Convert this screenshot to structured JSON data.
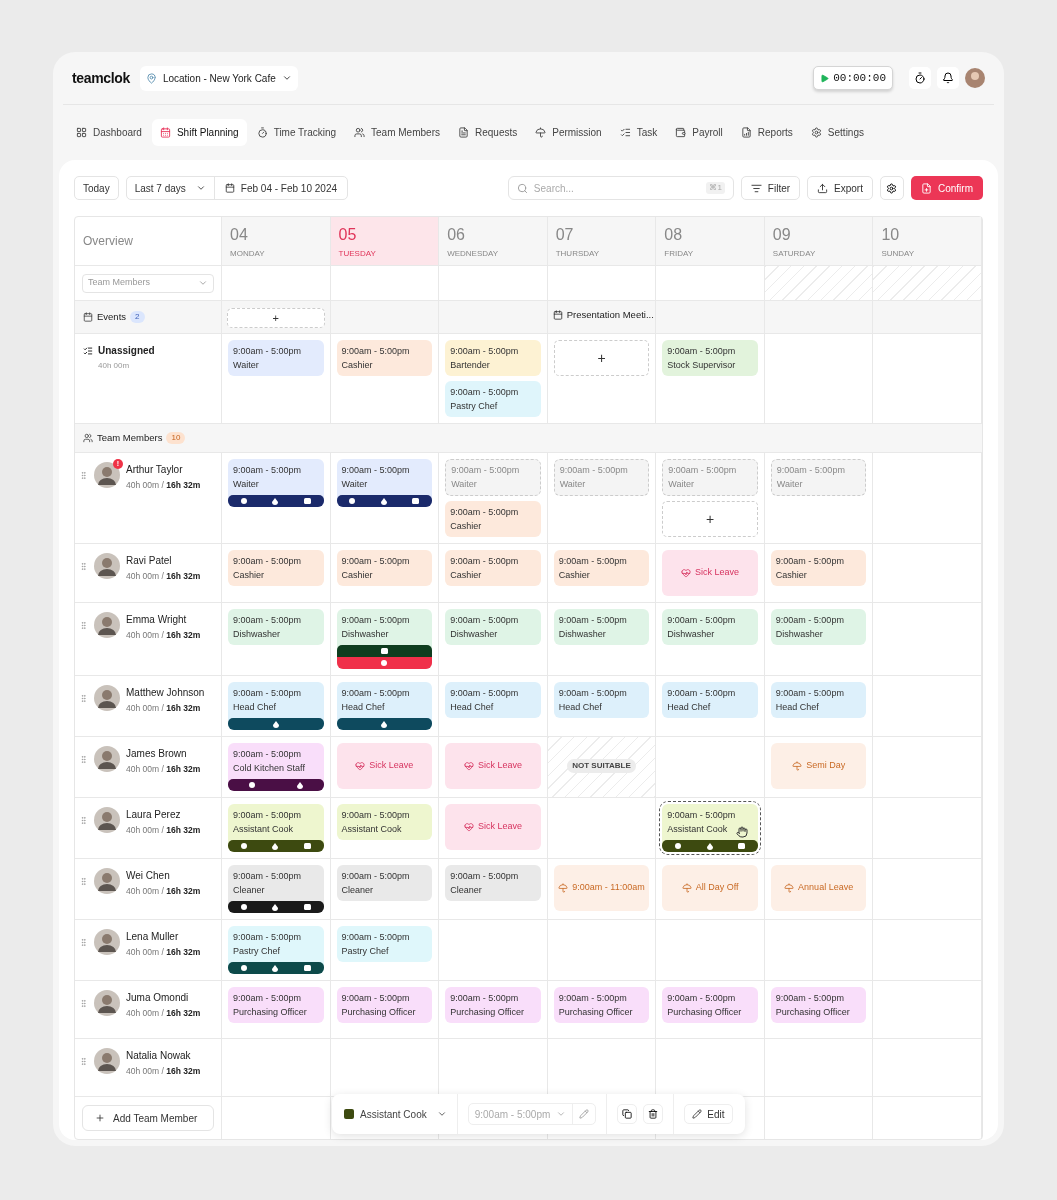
{
  "brand": "teamclok",
  "location": "Location - New York Cafe",
  "timer": "00:00:00",
  "nav": [
    {
      "label": "Dashboard",
      "selected": false
    },
    {
      "label": "Shift Planning",
      "selected": true
    },
    {
      "label": "Time Tracking",
      "selected": false
    },
    {
      "label": "Team Members",
      "selected": false
    },
    {
      "label": "Requests",
      "selected": false
    },
    {
      "label": "Permission",
      "selected": false
    },
    {
      "label": "Task",
      "selected": false
    },
    {
      "label": "Payroll",
      "selected": false
    },
    {
      "label": "Reports",
      "selected": false
    },
    {
      "label": "Settings",
      "selected": false
    }
  ],
  "toolbar": {
    "today": "Today",
    "range": "Last 7 days",
    "dates": "Feb 04 - Feb 10 2024",
    "search_placeholder": "Search...",
    "shortcut": "⌘1",
    "filter": "Filter",
    "export": "Export",
    "confirm": "Confirm"
  },
  "overview": "Overview",
  "member_filter": "Team Members",
  "days": [
    {
      "date": "04",
      "name": "MONDAY",
      "selected": false,
      "weekend": false
    },
    {
      "date": "05",
      "name": "TUESDAY",
      "selected": true,
      "weekend": false
    },
    {
      "date": "06",
      "name": "WEDNESDAY",
      "selected": false,
      "weekend": false
    },
    {
      "date": "07",
      "name": "THURSDAY",
      "selected": false,
      "weekend": false
    },
    {
      "date": "08",
      "name": "FRIDAY",
      "selected": false,
      "weekend": false
    },
    {
      "date": "09",
      "name": "SATURDAY",
      "selected": false,
      "weekend": true
    },
    {
      "date": "10",
      "name": "SUNDAY",
      "selected": false,
      "weekend": true
    }
  ],
  "events": {
    "label": "Events",
    "count": "2",
    "cells": [
      {
        "kind": "add",
        "text": "+"
      },
      null,
      null,
      {
        "kind": "event",
        "text": "Presentation Meeti..."
      },
      null,
      null,
      null
    ]
  },
  "unassigned": {
    "name": "Unassigned",
    "hours": "40h 00m",
    "cells": [
      [
        {
          "kind": "shift",
          "time": "9:00am - 5:00pm",
          "role": "Waiter",
          "color": "#e3ebfd",
          "selected": false
        }
      ],
      [
        {
          "kind": "shift",
          "time": "9:00am - 5:00pm",
          "role": "Cashier",
          "color": "#fde9dc",
          "selected": false
        }
      ],
      [
        {
          "kind": "shift",
          "time": "9:00am - 5:00pm",
          "role": "Bartender",
          "color": "#fdf2d3",
          "selected": false
        },
        {
          "kind": "shift",
          "time": "9:00am - 5:00pm",
          "role": "Pastry Chef",
          "color": "#dff5fb",
          "selected": false
        }
      ],
      [
        {
          "kind": "add",
          "text": "+"
        }
      ],
      [
        {
          "kind": "shift",
          "time": "9:00am - 5:00pm",
          "role": "Stock Supervisor",
          "color": "#e2f3dc",
          "selected": false
        }
      ],
      [],
      []
    ]
  },
  "team": {
    "label": "Team Members",
    "count": "10",
    "add": "Add Team Member",
    "members": [
      {
        "name": "Arthur Taylor",
        "hours": "40h 00m / **16h 32m**",
        "badge": "!",
        "cells": [
          [
            {
              "kind": "shift",
              "time": "9:00am - 5:00pm",
              "role": "Waiter",
              "color": "#e3ebfd",
              "selected": false,
              "bars": [
                {
                  "color": "#1b2a6b",
                  "marks": [
                    {
                      "kind": "dot"
                    },
                    {
                      "kind": "drop"
                    },
                    {
                      "kind": "note"
                    }
                  ]
                }
              ]
            }
          ],
          [
            {
              "kind": "shift",
              "time": "9:00am - 5:00pm",
              "role": "Waiter",
              "color": "#e3ebfd",
              "selected": false,
              "bars": [
                {
                  "color": "#1b2a6b",
                  "marks": [
                    {
                      "kind": "dot"
                    },
                    {
                      "kind": "drop"
                    },
                    {
                      "kind": "note"
                    }
                  ]
                }
              ]
            }
          ],
          [
            {
              "kind": "draft",
              "time": "9:00am - 5:00pm",
              "role": "Waiter"
            },
            {
              "kind": "shift",
              "time": "9:00am - 5:00pm",
              "role": "Cashier",
              "color": "#fde9dc",
              "selected": false
            }
          ],
          [
            {
              "kind": "draft",
              "time": "9:00am - 5:00pm",
              "role": "Waiter"
            }
          ],
          [
            {
              "kind": "draft",
              "time": "9:00am - 5:00pm",
              "role": "Waiter"
            },
            {
              "kind": "add",
              "text": "+"
            }
          ],
          [
            {
              "kind": "draft",
              "time": "9:00am - 5:00pm",
              "role": "Waiter"
            }
          ],
          []
        ]
      },
      {
        "name": "Ravi Patel",
        "hours": "40h 00m / **16h 32m**",
        "cells": [
          [
            {
              "kind": "shift",
              "time": "9:00am - 5:00pm",
              "role": "Cashier",
              "color": "#fde9dc",
              "selected": false
            }
          ],
          [
            {
              "kind": "shift",
              "time": "9:00am - 5:00pm",
              "role": "Cashier",
              "color": "#fde9dc",
              "selected": false
            }
          ],
          [
            {
              "kind": "shift",
              "time": "9:00am - 5:00pm",
              "role": "Cashier",
              "color": "#fde9dc",
              "selected": false
            }
          ],
          [
            {
              "kind": "shift",
              "time": "9:00am - 5:00pm",
              "role": "Cashier",
              "color": "#fde9dc",
              "selected": false
            }
          ],
          [
            {
              "kind": "sick",
              "text": "Sick Leave"
            }
          ],
          [
            {
              "kind": "shift",
              "time": "9:00am - 5:00pm",
              "role": "Cashier",
              "color": "#fde9dc",
              "selected": false
            }
          ],
          []
        ]
      },
      {
        "name": "Emma Wright",
        "hours": "40h 00m / **16h 32m**",
        "cells": [
          [
            {
              "kind": "shift",
              "time": "9:00am - 5:00pm",
              "role": "Dishwasher",
              "color": "#dff4e6",
              "selected": false
            }
          ],
          [
            {
              "kind": "shift",
              "time": "9:00am - 5:00pm",
              "role": "Dishwasher",
              "color": "#dff4e6",
              "selected": false,
              "bars": [
                {
                  "color": "#0f3d1f",
                  "marks": [
                    {
                      "kind": "note"
                    }
                  ]
                },
                {
                  "color": "#f0304a",
                  "marks": [
                    {
                      "kind": "dot"
                    }
                  ]
                }
              ]
            }
          ],
          [
            {
              "kind": "shift",
              "time": "9:00am - 5:00pm",
              "role": "Dishwasher",
              "color": "#dff4e6",
              "selected": false
            }
          ],
          [
            {
              "kind": "shift",
              "time": "9:00am - 5:00pm",
              "role": "Dishwasher",
              "color": "#dff4e6",
              "selected": false
            }
          ],
          [
            {
              "kind": "shift",
              "time": "9:00am - 5:00pm",
              "role": "Dishwasher",
              "color": "#dff4e6",
              "selected": false
            }
          ],
          [
            {
              "kind": "shift",
              "time": "9:00am - 5:00pm",
              "role": "Dishwasher",
              "color": "#dff4e6",
              "selected": false
            }
          ],
          []
        ]
      },
      {
        "name": "Matthew Johnson",
        "hours": "40h 00m / **16h 32m**",
        "cells": [
          [
            {
              "kind": "shift",
              "time": "9:00am - 5:00pm",
              "role": "Head Chef",
              "color": "#ddf0fb",
              "selected": false,
              "bars": [
                {
                  "color": "#0e4a5e",
                  "marks": [
                    {
                      "kind": "drop"
                    }
                  ]
                }
              ]
            }
          ],
          [
            {
              "kind": "shift",
              "time": "9:00am - 5:00pm",
              "role": "Head Chef",
              "color": "#ddf0fb",
              "selected": false,
              "bars": [
                {
                  "color": "#0e4a5e",
                  "marks": [
                    {
                      "kind": "drop"
                    }
                  ]
                }
              ]
            }
          ],
          [
            {
              "kind": "shift",
              "time": "9:00am - 5:00pm",
              "role": "Head Chef",
              "color": "#ddf0fb",
              "selected": false
            }
          ],
          [
            {
              "kind": "shift",
              "time": "9:00am - 5:00pm",
              "role": "Head Chef",
              "color": "#ddf0fb",
              "selected": false
            }
          ],
          [
            {
              "kind": "shift",
              "time": "9:00am - 5:00pm",
              "role": "Head Chef",
              "color": "#ddf0fb",
              "selected": false
            }
          ],
          [
            {
              "kind": "shift",
              "time": "9:00am - 5:00pm",
              "role": "Head Chef",
              "color": "#ddf0fb",
              "selected": false
            }
          ],
          []
        ]
      },
      {
        "name": "James Brown",
        "hours": "40h 00m / **16h 32m**",
        "cells": [
          [
            {
              "kind": "shift",
              "time": "9:00am - 5:00pm",
              "role": "Cold Kitchen Staff",
              "color": "#f9defa",
              "selected": false,
              "bars": [
                {
                  "color": "#4a0f45",
                  "marks": [
                    {
                      "kind": "dot"
                    },
                    {
                      "kind": "drop"
                    }
                  ]
                }
              ]
            }
          ],
          [
            {
              "kind": "sick",
              "text": "Sick Leave"
            }
          ],
          [
            {
              "kind": "sick",
              "text": "Sick Leave"
            }
          ],
          [
            {
              "kind": "unsuitable",
              "text": "NOT SUITABLE"
            }
          ],
          [],
          [
            {
              "kind": "leave",
              "text": "Semi Day"
            }
          ],
          []
        ]
      },
      {
        "name": "Laura Perez",
        "hours": "40h 00m / **16h 32m**",
        "cells": [
          [
            {
              "kind": "shift",
              "time": "9:00am - 5:00pm",
              "role": "Assistant Cook",
              "color": "#eef6cf",
              "selected": false,
              "bars": [
                {
                  "color": "#3d4a10",
                  "marks": [
                    {
                      "kind": "dot"
                    },
                    {
                      "kind": "drop"
                    },
                    {
                      "kind": "note"
                    }
                  ]
                }
              ]
            }
          ],
          [
            {
              "kind": "shift",
              "time": "9:00am - 5:00pm",
              "role": "Assistant Cook",
              "color": "#eef6cf",
              "selected": false
            }
          ],
          [
            {
              "kind": "sick",
              "text": "Sick Leave"
            }
          ],
          [],
          [
            {
              "kind": "shift",
              "time": "9:00am - 5:00pm",
              "role": "Assistant Cook",
              "color": "#eef6cf",
              "selected": true,
              "bars": [
                {
                  "color": "#3d4a10",
                  "marks": [
                    {
                      "kind": "dot"
                    },
                    {
                      "kind": "drop"
                    },
                    {
                      "kind": "note"
                    }
                  ]
                }
              ]
            }
          ],
          [],
          []
        ]
      },
      {
        "name": "Wei Chen",
        "hours": "40h 00m / **16h 32m**",
        "cells": [
          [
            {
              "kind": "shift",
              "time": "9:00am - 5:00pm",
              "role": "Cleaner",
              "color": "#e9e9e9",
              "selected": false,
              "bars": [
                {
                  "color": "#1a1a1a",
                  "marks": [
                    {
                      "kind": "dot"
                    },
                    {
                      "kind": "drop"
                    },
                    {
                      "kind": "note"
                    }
                  ]
                }
              ]
            }
          ],
          [
            {
              "kind": "shift",
              "time": "9:00am - 5:00pm",
              "role": "Cleaner",
              "color": "#e9e9e9",
              "selected": false
            }
          ],
          [
            {
              "kind": "shift",
              "time": "9:00am - 5:00pm",
              "role": "Cleaner",
              "color": "#e9e9e9",
              "selected": false
            }
          ],
          [
            {
              "kind": "leave",
              "text": "9:00am - 11:00am"
            }
          ],
          [
            {
              "kind": "leave",
              "text": "All Day Off"
            }
          ],
          [
            {
              "kind": "leave",
              "text": "Annual Leave"
            }
          ],
          []
        ]
      },
      {
        "name": "Lena Muller",
        "hours": "40h 00m / **16h 32m**",
        "cells": [
          [
            {
              "kind": "shift",
              "time": "9:00am - 5:00pm",
              "role": "Pastry Chef",
              "color": "#dff7fb",
              "selected": false,
              "bars": [
                {
                  "color": "#0d4a4a",
                  "marks": [
                    {
                      "kind": "dot"
                    },
                    {
                      "kind": "drop"
                    },
                    {
                      "kind": "note"
                    }
                  ]
                }
              ]
            }
          ],
          [
            {
              "kind": "shift",
              "time": "9:00am - 5:00pm",
              "role": "Pastry Chef",
              "color": "#dff7fb",
              "selected": false
            }
          ],
          [],
          [],
          [],
          [],
          []
        ]
      },
      {
        "name": "Juma Omondi",
        "hours": "40h 00m / **16h 32m**",
        "cells": [
          [
            {
              "kind": "shift",
              "time": "9:00am - 5:00pm",
              "role": "Purchasing Officer",
              "color": "#f9defa",
              "selected": false
            }
          ],
          [
            {
              "kind": "shift",
              "time": "9:00am - 5:00pm",
              "role": "Purchasing Officer",
              "color": "#f9defa",
              "selected": false
            }
          ],
          [
            {
              "kind": "shift",
              "time": "9:00am - 5:00pm",
              "role": "Purchasing Officer",
              "color": "#f9defa",
              "selected": false
            }
          ],
          [
            {
              "kind": "shift",
              "time": "9:00am - 5:00pm",
              "role": "Purchasing Officer",
              "color": "#f9defa",
              "selected": false
            }
          ],
          [
            {
              "kind": "shift",
              "time": "9:00am - 5:00pm",
              "role": "Purchasing Officer",
              "color": "#f9defa",
              "selected": false
            }
          ],
          [
            {
              "kind": "shift",
              "time": "9:00am - 5:00pm",
              "role": "Purchasing Officer",
              "color": "#f9defa",
              "selected": false
            }
          ],
          []
        ]
      },
      {
        "name": "Natalia Nowak",
        "hours": "40h 00m / **16h 32m**",
        "cells": [
          [],
          [],
          [],
          [],
          [],
          [],
          []
        ]
      }
    ]
  },
  "action_bar": {
    "role": "Assistant Cook",
    "color": "#3d4a10",
    "time": "9:00am - 5:00pm",
    "edit": "Edit"
  }
}
